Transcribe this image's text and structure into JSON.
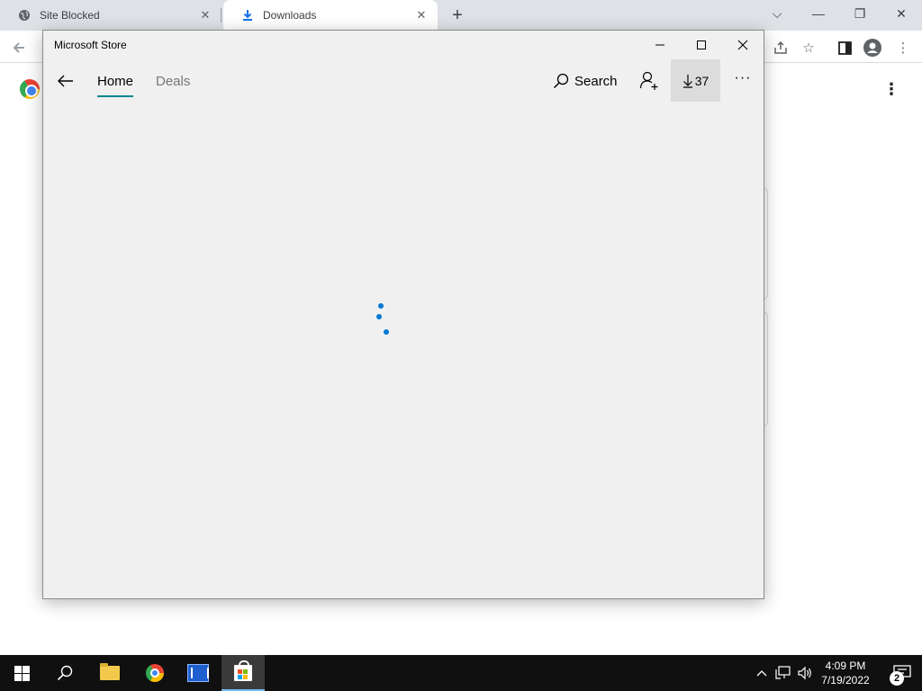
{
  "chrome": {
    "tabs": [
      {
        "title": "Site Blocked",
        "icon": "globe-icon"
      },
      {
        "title": "Downloads",
        "icon": "download-icon"
      }
    ]
  },
  "store": {
    "window_title": "Microsoft Store",
    "nav": {
      "home": "Home",
      "deals": "Deals"
    },
    "search_label": "Search",
    "downloads_count": "37",
    "more_label": "···",
    "accent_color": "#00878a",
    "spinner_color": "#0078d4"
  },
  "taskbar": {
    "time": "4:09 PM",
    "date": "7/19/2022",
    "notification_count": "2"
  }
}
